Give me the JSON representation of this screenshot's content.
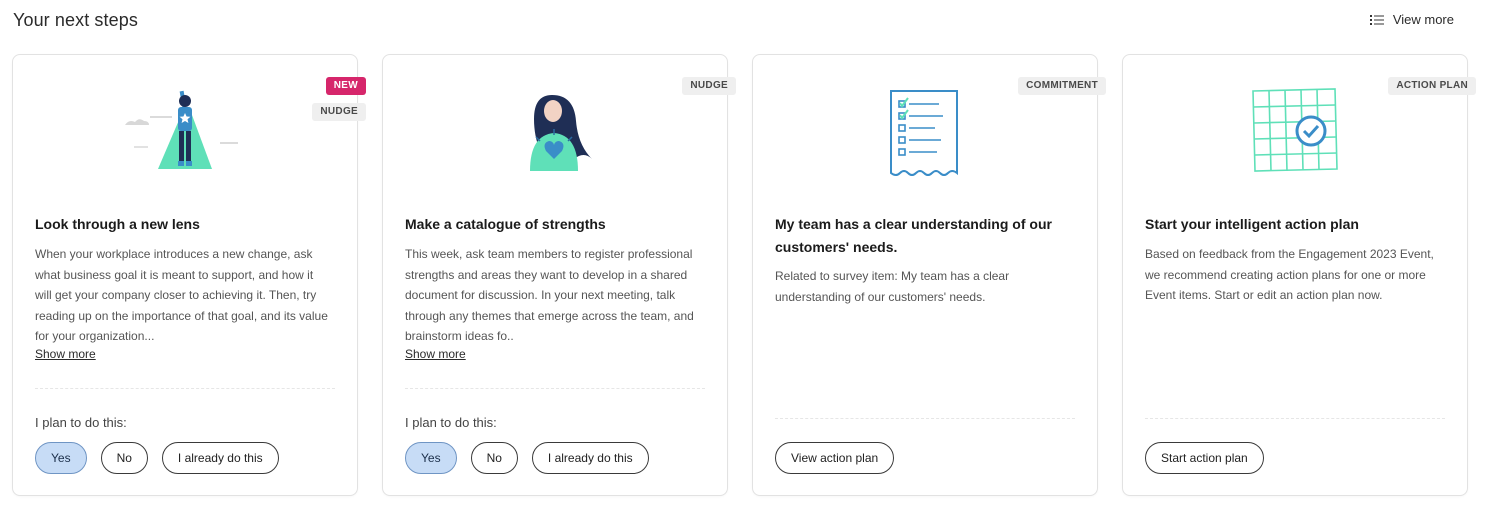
{
  "header": {
    "title": "Your next steps",
    "view_more_label": "View more",
    "view_more_icon": "list-icon"
  },
  "colors": {
    "accent": "#c7dcf6",
    "new_badge": "#d6266b",
    "teal": "#5fe0b8",
    "blue": "#3a8dc8"
  },
  "cards": [
    {
      "badges": [
        "NEW",
        "NUDGE"
      ],
      "illustration": "superhero-illustration",
      "title": "Look through a new lens",
      "body": "When your workplace introduces a new change, ask what business goal it is meant to support, and how it will get your company closer to achieving it. Then, try reading up on the importance of that goal, and its value for your organization...",
      "show_more": "Show more",
      "plan_label": "I plan to do this:",
      "options": [
        "Yes",
        "No",
        "I already do this"
      ],
      "selected": "Yes"
    },
    {
      "badges": [
        "NUDGE"
      ],
      "illustration": "person-holding-heart-illustration",
      "title": "Make a catalogue of strengths",
      "body": "This week, ask team members to register professional strengths and areas they want to develop in a shared document for discussion. In your next meeting, talk through any themes that emerge across the team, and brainstorm ideas fo..",
      "show_more": "Show more",
      "plan_label": "I plan to do this:",
      "options": [
        "Yes",
        "No",
        "I already do this"
      ],
      "selected": "Yes"
    },
    {
      "badges": [
        "COMMITMENT"
      ],
      "illustration": "checklist-illustration",
      "title": "My team has a clear understanding of our customers' needs.",
      "body": "Related to survey item: My team has a clear understanding of our customers' needs.",
      "action": "View action plan"
    },
    {
      "badges": [
        "ACTION PLAN"
      ],
      "illustration": "calendar-check-illustration",
      "title": "Start your intelligent action plan",
      "body": "Based on feedback from the Engagement 2023 Event, we recommend creating action plans for one or more Event items. Start or edit an action plan now.",
      "action": "Start action plan"
    }
  ]
}
